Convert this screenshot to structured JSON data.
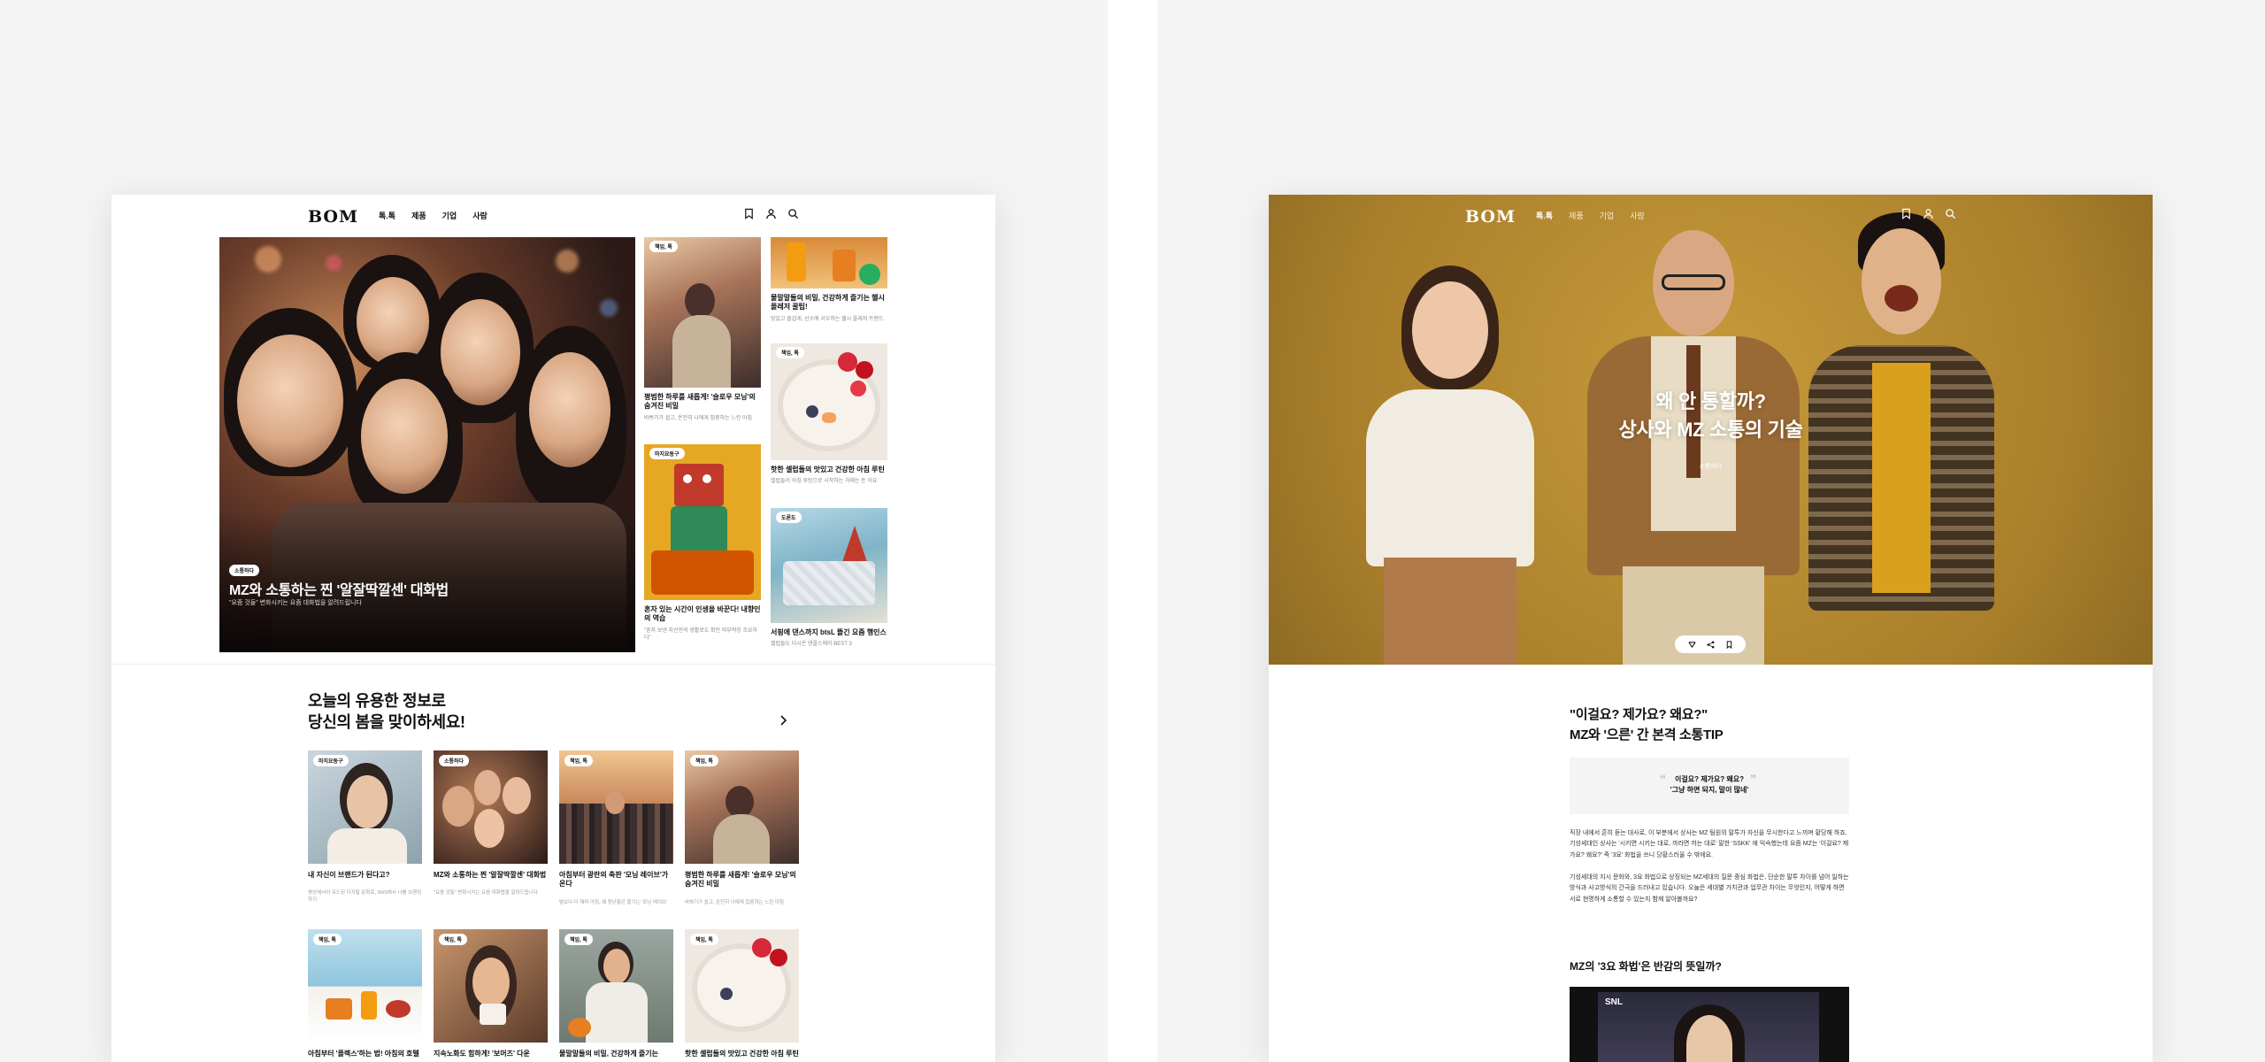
{
  "left": {
    "nav": {
      "logo": "BOM",
      "menu": [
        "톡.톡",
        "제품",
        "기업",
        "사람"
      ]
    },
    "hero": {
      "tag": "소통하다",
      "title": "MZ와 소통하는 찐 '알잘딱깔센' 대화법",
      "subtitle": "\"요즘 것들\" 변화시키는 요즘 대화법을 알려드립니다"
    },
    "cards": [
      {
        "tag": "책임, 톡",
        "title": "평범한 하루를 새롭게! '슬로우 모닝'의 숨겨진 비밀",
        "sub": "바쁘기가 쉽고, 온전히 나에게 집중하는 느린 아침"
      },
      {
        "tag": "마지요동구",
        "title": "혼자 있는 시간이 인생을 바꾼다! 내향인의 역습",
        "sub": "\"혼자 보낸 자신만의 생활로도 확인 외부적응 조요하다\""
      },
      {
        "tag": "",
        "title": "물말말들의 비밀, 건강하게 즐기는 헬시플레저 꿀팁!",
        "sub": "맛있고 즐겁게, 산소에 서우하는 헬시 플레저 트렌드"
      },
      {
        "tag": "책임, 톡",
        "title": "핫한 셀럽들의 맛있고 건강한 아침 루틴",
        "sub": "셀럽들이 아침 루틴으로 시작하는 거에는 돈 이유"
      },
      {
        "tag": "도론도",
        "title": "서핑에 댄스까지 btsL 뜰긴 요즘 행인스",
        "sub": "셀럽들도 다시온 댄플스에이 BEST 3"
      }
    ],
    "section": {
      "title_line1": "오늘의 유용한 정보로",
      "title_line2": "당신의 봄을 맞이하세요!"
    },
    "grid": [
      {
        "tag": "마지요동구",
        "title": "내 자신이 브랜드가 된다고?",
        "sub": "평상에서이 유드된 디지털 문화로, SNS에서 나를 브랜딩하기"
      },
      {
        "tag": "소통하다",
        "title": "MZ와 소통하는 찐 '알잘딱깔센' 대화법",
        "sub": "\"요즘 것들\" 변화시키는 요즘 대화법을 알려드립니다"
      },
      {
        "tag": "책임, 톡",
        "title": "아침부터 광란의 축판 '모닝 레이브'가 온다",
        "sub": "밤보다 더 재미 아침, 왜 청년들은 즐기는 '모닝 레이브'"
      },
      {
        "tag": "책임, 톡",
        "title": "평범한 하루를 새롭게! '슬로우 모닝'의 숨겨진 비밀",
        "sub": "바쁘기가 쉽고, 온전히 나에게 집중하는 느린 아침"
      },
      {
        "tag": "책임, 톡",
        "title": "아침부터 '플렉스'하는 법! 아침의 호텔",
        "sub": ""
      },
      {
        "tag": "책임, 톡",
        "title": "지속노화도 힘하게! '보머즈' 다운",
        "sub": ""
      },
      {
        "tag": "책임, 톡",
        "title": "물말말들의 비밀, 건강하게 즐기는",
        "sub": ""
      },
      {
        "tag": "책임, 톡",
        "title": "핫한 셀럽들의 맛있고 건강한 아침 루틴",
        "sub": ""
      }
    ]
  },
  "right": {
    "nav": {
      "logo": "BOM",
      "menu": [
        "톡.톡",
        "제품",
        "기업",
        "사람"
      ]
    },
    "hero": {
      "title_line1": "왜 안 통할까?",
      "title_line2": "상사와 MZ 소통의 기술",
      "tag": "소통하다"
    },
    "article": {
      "title_line1": "\"이걸요? 제가요? 왜요?\"",
      "title_line2": "MZ와 '으른' 간 본격 소통TIP",
      "quote_line1": "이걸요? 제가요? 왜요?",
      "quote_line2": "'그냥 하면 되지, 말이 많네'",
      "para1": "직장 내에서 흔히 듣는 대사로, 이 부분에서 상사는 MZ 팀원의 말투가 자신을 무시한다고 느끼며 황당해 하죠. 기성세대인 상사는 '시키면 시키는 대로, 까라면 까는 대로' 말한 'SSKK' 에 익숙했는데 요즘 MZ는 '이걸요? 제가요? 왜요?' 즉 '3요' 화법을 쓰니 당황스러울 수 밖에요.",
      "para2": "기성세대의 지시 문화와, 3요 화법으로 상징되는 MZ세대의 질문 중심 화법은, 단순한 말투 차이를 넘어 일하는 방식과 사고방식의 간극을 드러내고 있습니다. 오늘은 세대별 가치관과 업무관 차이는 무엇인지, 어떻게 하면 서로 현명하게 소통할 수 있는지 함께 알아볼까요?",
      "subheading": "MZ의 '3요 화법'은 반감의 뜻일까?",
      "video_badge": "SNL"
    }
  }
}
